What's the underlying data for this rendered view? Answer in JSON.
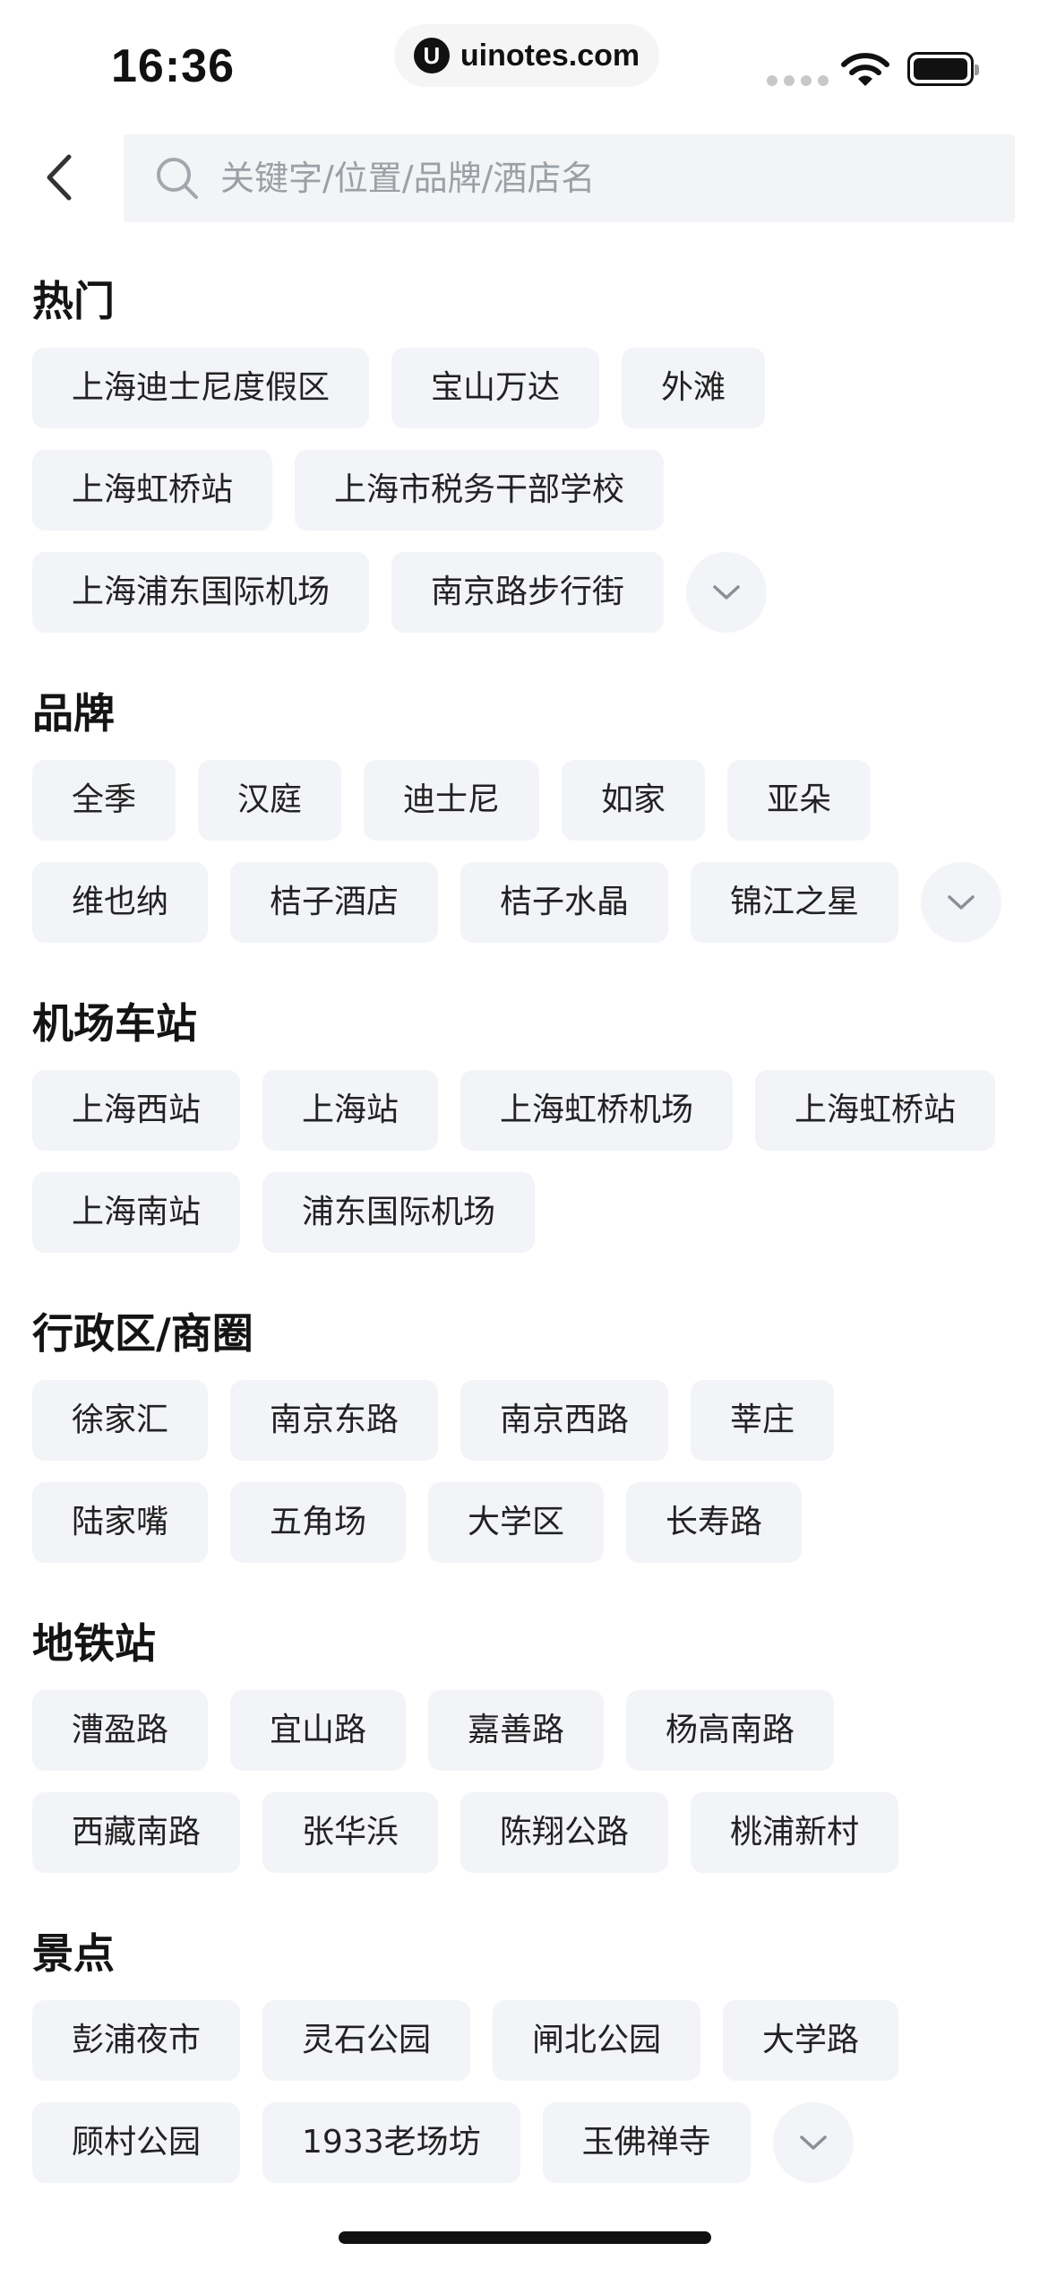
{
  "status_bar": {
    "time": "16:36",
    "url_logo": "U",
    "url": "uinotes.com"
  },
  "search": {
    "placeholder": "关键字/位置/品牌/酒店名",
    "value": ""
  },
  "sections": [
    {
      "title": "热门",
      "chips": [
        "上海迪士尼度假区",
        "宝山万达",
        "外滩",
        "上海虹桥站",
        "上海市税务干部学校",
        "上海浦东国际机场",
        "南京路步行街"
      ],
      "expandable": true
    },
    {
      "title": "品牌",
      "chips": [
        "全季",
        "汉庭",
        "迪士尼",
        "如家",
        "亚朵",
        "维也纳",
        "桔子酒店",
        "桔子水晶",
        "锦江之星"
      ],
      "expandable": true
    },
    {
      "title": "机场车站",
      "chips": [
        "上海西站",
        "上海站",
        "上海虹桥机场",
        "上海虹桥站",
        "上海南站",
        "浦东国际机场"
      ],
      "expandable": false
    },
    {
      "title": "行政区/商圈",
      "chips": [
        "徐家汇",
        "南京东路",
        "南京西路",
        "莘庄",
        "陆家嘴",
        "五角场",
        "大学区",
        "长寿路"
      ],
      "expandable": false
    },
    {
      "title": "地铁站",
      "chips": [
        "漕盈路",
        "宜山路",
        "嘉善路",
        "杨高南路",
        "西藏南路",
        "张华浜",
        "陈翔公路",
        "桃浦新村"
      ],
      "expandable": false
    },
    {
      "title": "景点",
      "chips": [
        "彭浦夜市",
        "灵石公园",
        "闸北公园",
        "大学路",
        "顾村公园",
        "1933老场坊",
        "玉佛禅寺"
      ],
      "expandable": true
    }
  ],
  "icons": {
    "back": "chevron-left-icon",
    "search": "search-icon",
    "expand": "chevron-down-icon"
  },
  "colors": {
    "chip_background": "#f3f4f8",
    "search_background": "#f3f4f6",
    "placeholder": "#9aa0a6",
    "text": "#222222"
  }
}
